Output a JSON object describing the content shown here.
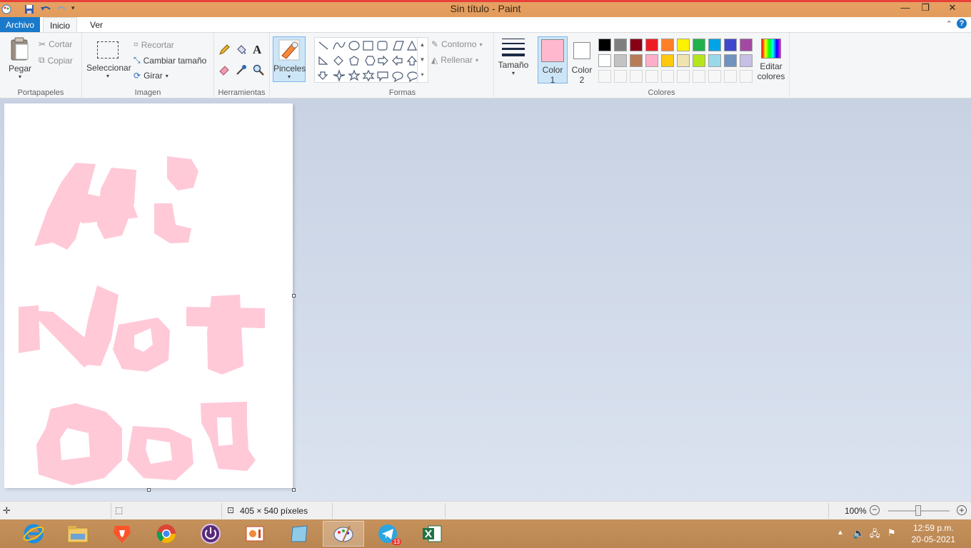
{
  "window": {
    "title": "Sin título - Paint"
  },
  "tabs": {
    "file": "Archivo",
    "home": "Inicio",
    "view": "Ver"
  },
  "clipboard": {
    "paste": "Pegar",
    "cut": "Cortar",
    "copy": "Copiar",
    "label": "Portapapeles"
  },
  "image": {
    "select": "Seleccionar",
    "crop": "Recortar",
    "resize": "Cambiar tamaño",
    "rotate": "Girar",
    "label": "Imagen"
  },
  "tools": {
    "label": "Herramientas"
  },
  "brushes": {
    "label": "Pinceles"
  },
  "shapes": {
    "outline": "Contorno",
    "fill": "Rellenar",
    "label": "Formas"
  },
  "size": {
    "label": "Tamaño"
  },
  "colors": {
    "color1_line1": "Color",
    "color1_line2": "1",
    "color2_line1": "Color",
    "color2_line2": "2",
    "edit_line1": "Editar",
    "edit_line2": "colores",
    "label": "Colores",
    "color1_value": "#ffb8cd",
    "color2_value": "#ffffff",
    "palette_row1": [
      "#000000",
      "#7f7f7f",
      "#880015",
      "#ed1c24",
      "#ff7f27",
      "#fff200",
      "#22b14c",
      "#00a2e8",
      "#3f48cc",
      "#a349a4"
    ],
    "palette_row2": [
      "#ffffff",
      "#c3c3c3",
      "#b97a57",
      "#ffaec9",
      "#ffc90e",
      "#efe4b0",
      "#b5e61d",
      "#99d9ea",
      "#7092be",
      "#c8bfe7"
    ]
  },
  "status": {
    "dimensions": "405 × 540 píxeles",
    "zoom": "100%"
  },
  "taskbar": {
    "time": "12:59 p.m.",
    "date": "20-05-2021",
    "telegram_badge": "13"
  }
}
